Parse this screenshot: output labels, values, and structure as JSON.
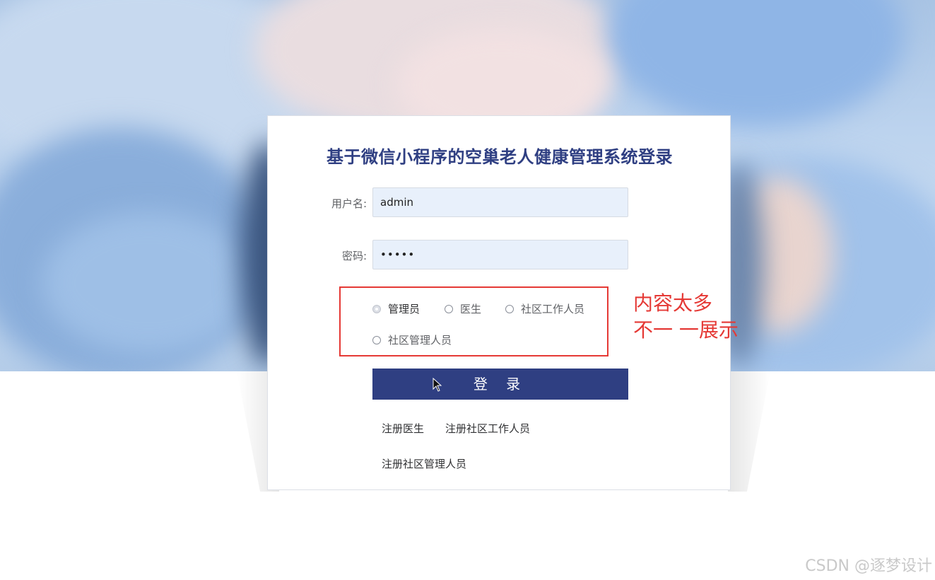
{
  "login": {
    "title": "基于微信小程序的空巢老人健康管理系统登录",
    "username_label": "用户名:",
    "username_value": "admin",
    "password_label": "密码:",
    "password_value": "•••••",
    "roles": [
      {
        "label": "管理员",
        "selected": true
      },
      {
        "label": "医生",
        "selected": false
      },
      {
        "label": "社区工作人员",
        "selected": false
      },
      {
        "label": "社区管理人员",
        "selected": false
      }
    ],
    "login_button": "登 录",
    "register_links": [
      "注册医生",
      "注册社区工作人员",
      "注册社区管理人员"
    ]
  },
  "annotation": {
    "line1": "内容太多",
    "line2": "不一 一展示",
    "color": "#e53935"
  },
  "watermark": "CSDN @逐梦设计",
  "colors": {
    "primary": "#2f3f82",
    "input_bg": "#e8f0fb"
  }
}
